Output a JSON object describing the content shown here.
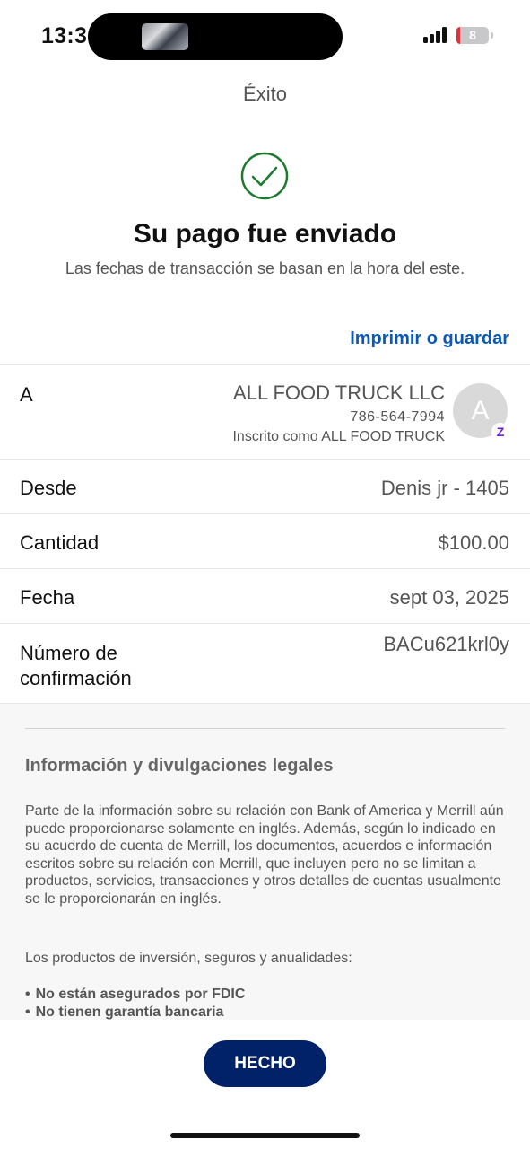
{
  "status_bar": {
    "time": "13:3",
    "battery_level": "8",
    "battery_fraction": 0.08
  },
  "header": {
    "title": "Éxito",
    "success_icon": "checkmark-circle-icon",
    "headline": "Su pago fue enviado",
    "subline": "Las fechas de transacción se basan en la hora del este.",
    "print_label": "Imprimir o guardar"
  },
  "details": {
    "to": {
      "label": "A",
      "name": "ALL FOOD TRUCK LLC",
      "phone": "786-564-7994",
      "enrolled": "Inscrito como ALL FOOD TRUCK",
      "avatar_initial": "A",
      "badge_icon": "zelle-icon",
      "badge_glyph": "Z"
    },
    "from": {
      "label": "Desde",
      "value": "Denis jr - 1405"
    },
    "amount": {
      "label": "Cantidad",
      "value": "$100.00"
    },
    "date": {
      "label": "Fecha",
      "value": "sept 03, 2025"
    },
    "confirmation": {
      "label": "Número de confirmación",
      "value": "BACu621krl0y"
    }
  },
  "legal": {
    "title": "Información y divulgaciones legales",
    "body": "Parte de la información sobre su relación con Bank of America y Merrill aún puede proporcionarse solamente en inglés. Además, según lo indicado en su acuerdo de cuenta de Merrill, los documentos, acuerdos e información escritos sobre su relación con Merrill, que incluyen pero no se limitan a productos, servicios, transacciones y otros detalles de cuentas usualmente se le proporcionarán en inglés.",
    "intro": "Los productos de inversión, seguros y anualidades:",
    "items": [
      "No están asegurados por FDIC",
      "No tienen garantía bancaria"
    ]
  },
  "footer": {
    "done_label": "HECHO"
  },
  "colors": {
    "link": "#0a59b8",
    "primary_button": "#012169",
    "success": "#1e7a2e",
    "battery_low": "#e5303a",
    "zelle": "#6d1ed4"
  }
}
